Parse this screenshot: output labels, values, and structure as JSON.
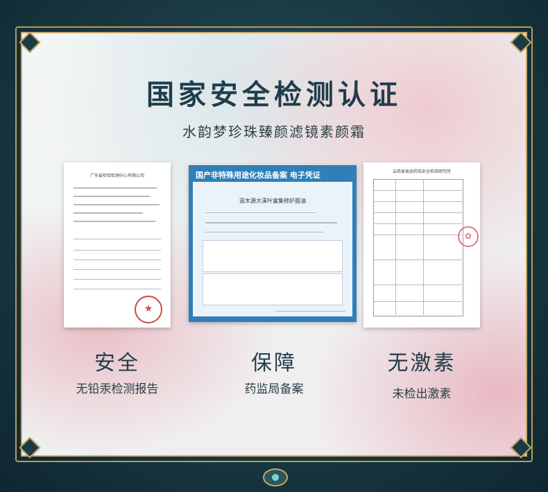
{
  "title": "国家安全检测认证",
  "subtitle": "水韵梦珍珠臻颜滤镜素颜霜",
  "documents": [
    {
      "header": "广东省检验检测中心有限公司",
      "stamp": "★"
    },
    {
      "header": "国产非特殊用途化妆品备案 电子凭证",
      "product": "滋木源大溪叶富集修护面油"
    },
    {
      "header": "云南省食品药品安全检测研究所",
      "stamp": "✿"
    }
  ],
  "badges": [
    {
      "title": "安全",
      "desc": "无铅汞检测报告"
    },
    {
      "title": "保障",
      "desc": "药监局备案"
    },
    {
      "title": "无激素",
      "desc": "未检出激素"
    }
  ]
}
